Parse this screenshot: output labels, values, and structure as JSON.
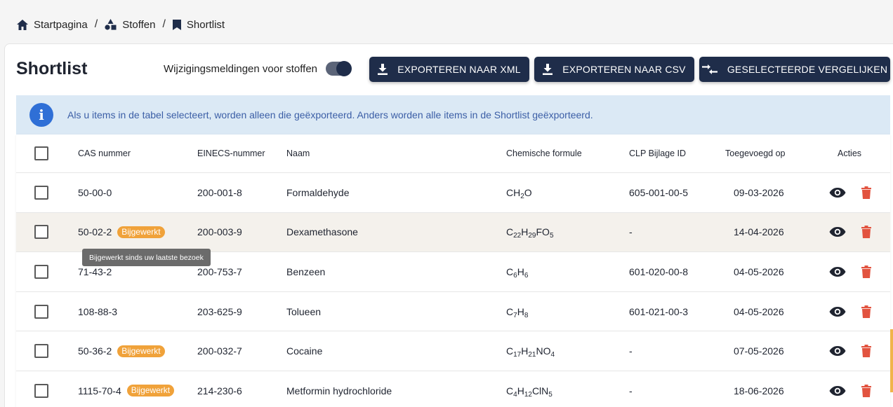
{
  "breadcrumb": {
    "items": [
      {
        "label": "Startpagina",
        "icon": "home-icon"
      },
      {
        "label": "Stoffen",
        "icon": "shapes-icon"
      },
      {
        "label": "Shortlist",
        "icon": "bookmark-icon"
      }
    ],
    "separator": "/"
  },
  "page": {
    "title": "Shortlist",
    "toggle_label": "Wijzigingsmeldingen voor stoffen",
    "toggle_on": true
  },
  "toolbar": {
    "export_xml": "EXPORTEREN NAAR XML",
    "export_csv": "EXPORTEREN NAAR CSV",
    "compare": "GESELECTEERDE VERGELIJKEN"
  },
  "info": {
    "icon": "info-icon",
    "text": "Als u items in de tabel selecteert, worden alleen die geëxporteerd. Anders worden alle items in de Shortlist geëxporteerd."
  },
  "table": {
    "headers": {
      "cas": "CAS nummer",
      "einecs": "EINECS-nummer",
      "naam": "Naam",
      "formule": "Chemische formule",
      "clp": "CLP Bijlage ID",
      "toegevoegd": "Toegevoegd op",
      "acties": "Acties"
    },
    "badge_label": "Bijgewerkt",
    "tooltip": "Bijgewerkt sinds uw laatste bezoek",
    "rows": [
      {
        "cas": "50-00-0",
        "updated": false,
        "einecs": "200-001-8",
        "naam": "Formaldehyde",
        "formula": [
          [
            "CH",
            ""
          ],
          [
            "",
            "2"
          ],
          [
            "O",
            ""
          ]
        ],
        "clp": "605-001-00-5",
        "date": "09-03-2026"
      },
      {
        "cas": "50-02-2",
        "updated": true,
        "einecs": "200-003-9",
        "naam": "Dexamethasone",
        "formula": [
          [
            "C",
            ""
          ],
          [
            "",
            "22"
          ],
          [
            "H",
            ""
          ],
          [
            "",
            "29"
          ],
          [
            "FO",
            ""
          ],
          [
            "",
            "5"
          ]
        ],
        "clp": "-",
        "date": "14-04-2026"
      },
      {
        "cas": "71-43-2",
        "updated": false,
        "einecs": "200-753-7",
        "naam": "Benzeen",
        "formula": [
          [
            "C",
            ""
          ],
          [
            "",
            "6"
          ],
          [
            "H",
            ""
          ],
          [
            "",
            "6"
          ]
        ],
        "clp": "601-020-00-8",
        "date": "04-05-2026"
      },
      {
        "cas": "108-88-3",
        "updated": false,
        "einecs": "203-625-9",
        "naam": "Tolueen",
        "formula": [
          [
            "C",
            ""
          ],
          [
            "",
            "7"
          ],
          [
            "H",
            ""
          ],
          [
            "",
            "8"
          ]
        ],
        "clp": "601-021-00-3",
        "date": "04-05-2026"
      },
      {
        "cas": "50-36-2",
        "updated": true,
        "einecs": "200-032-7",
        "naam": "Cocaine",
        "formula": [
          [
            "C",
            ""
          ],
          [
            "",
            "17"
          ],
          [
            "H",
            ""
          ],
          [
            "",
            "21"
          ],
          [
            "NO",
            ""
          ],
          [
            "",
            "4"
          ]
        ],
        "clp": "-",
        "date": "07-05-2026"
      },
      {
        "cas": "1115-70-4",
        "updated": true,
        "einecs": "214-230-6",
        "naam": "Metformin hydrochloride",
        "formula": [
          [
            "C",
            ""
          ],
          [
            "",
            "4"
          ],
          [
            "H",
            ""
          ],
          [
            "",
            "12"
          ],
          [
            "ClN",
            ""
          ],
          [
            "",
            "5"
          ]
        ],
        "clp": "-",
        "date": "18-06-2026"
      }
    ]
  },
  "colors": {
    "primary": "#1f2d4a",
    "badge": "#f0a23a",
    "delete": "#e2533f",
    "info_bg": "#dbe9f5",
    "info_icon": "#2f6fd6"
  }
}
